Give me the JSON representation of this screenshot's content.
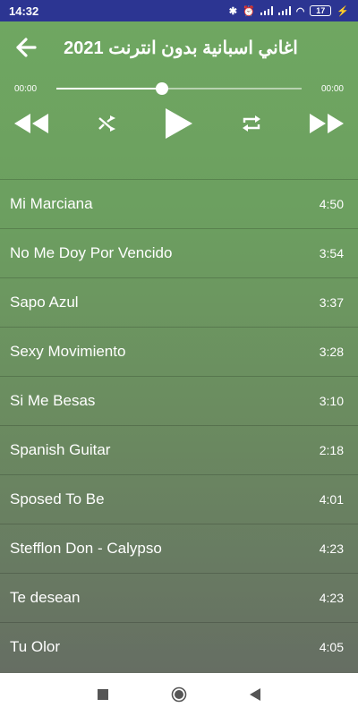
{
  "status": {
    "time": "14:32",
    "battery": "17"
  },
  "header": {
    "title": "اغاني اسبانية بدون انترنت 2021"
  },
  "player": {
    "elapsed": "00:00",
    "total": "00:00",
    "progress": 0.43
  },
  "icons": {
    "back": "arrow-left-icon",
    "rewind": "rewind-icon",
    "shuffle": "shuffle-icon",
    "play": "play-icon",
    "repeat": "repeat-icon",
    "forward": "fast-forward-icon"
  },
  "songs": [
    {
      "title": "Mi Marciana",
      "duration": "4:50"
    },
    {
      "title": "No Me Doy Por Vencido",
      "duration": "3:54"
    },
    {
      "title": "Sapo Azul",
      "duration": "3:37"
    },
    {
      "title": "Sexy Movimiento",
      "duration": "3:28"
    },
    {
      "title": "Si Me Besas",
      "duration": "3:10"
    },
    {
      "title": "Spanish Guitar",
      "duration": "2:18"
    },
    {
      "title": "Sposed To Be",
      "duration": "4:01"
    },
    {
      "title": "Stefflon Don - Calypso",
      "duration": "4:23"
    },
    {
      "title": "Te desean",
      "duration": "4:23"
    },
    {
      "title": "Tu Olor",
      "duration": "4:05"
    }
  ],
  "colors": {
    "statusbar": "#2c3592",
    "gradient_top": "#6fa761",
    "gradient_bottom": "#666e63"
  }
}
